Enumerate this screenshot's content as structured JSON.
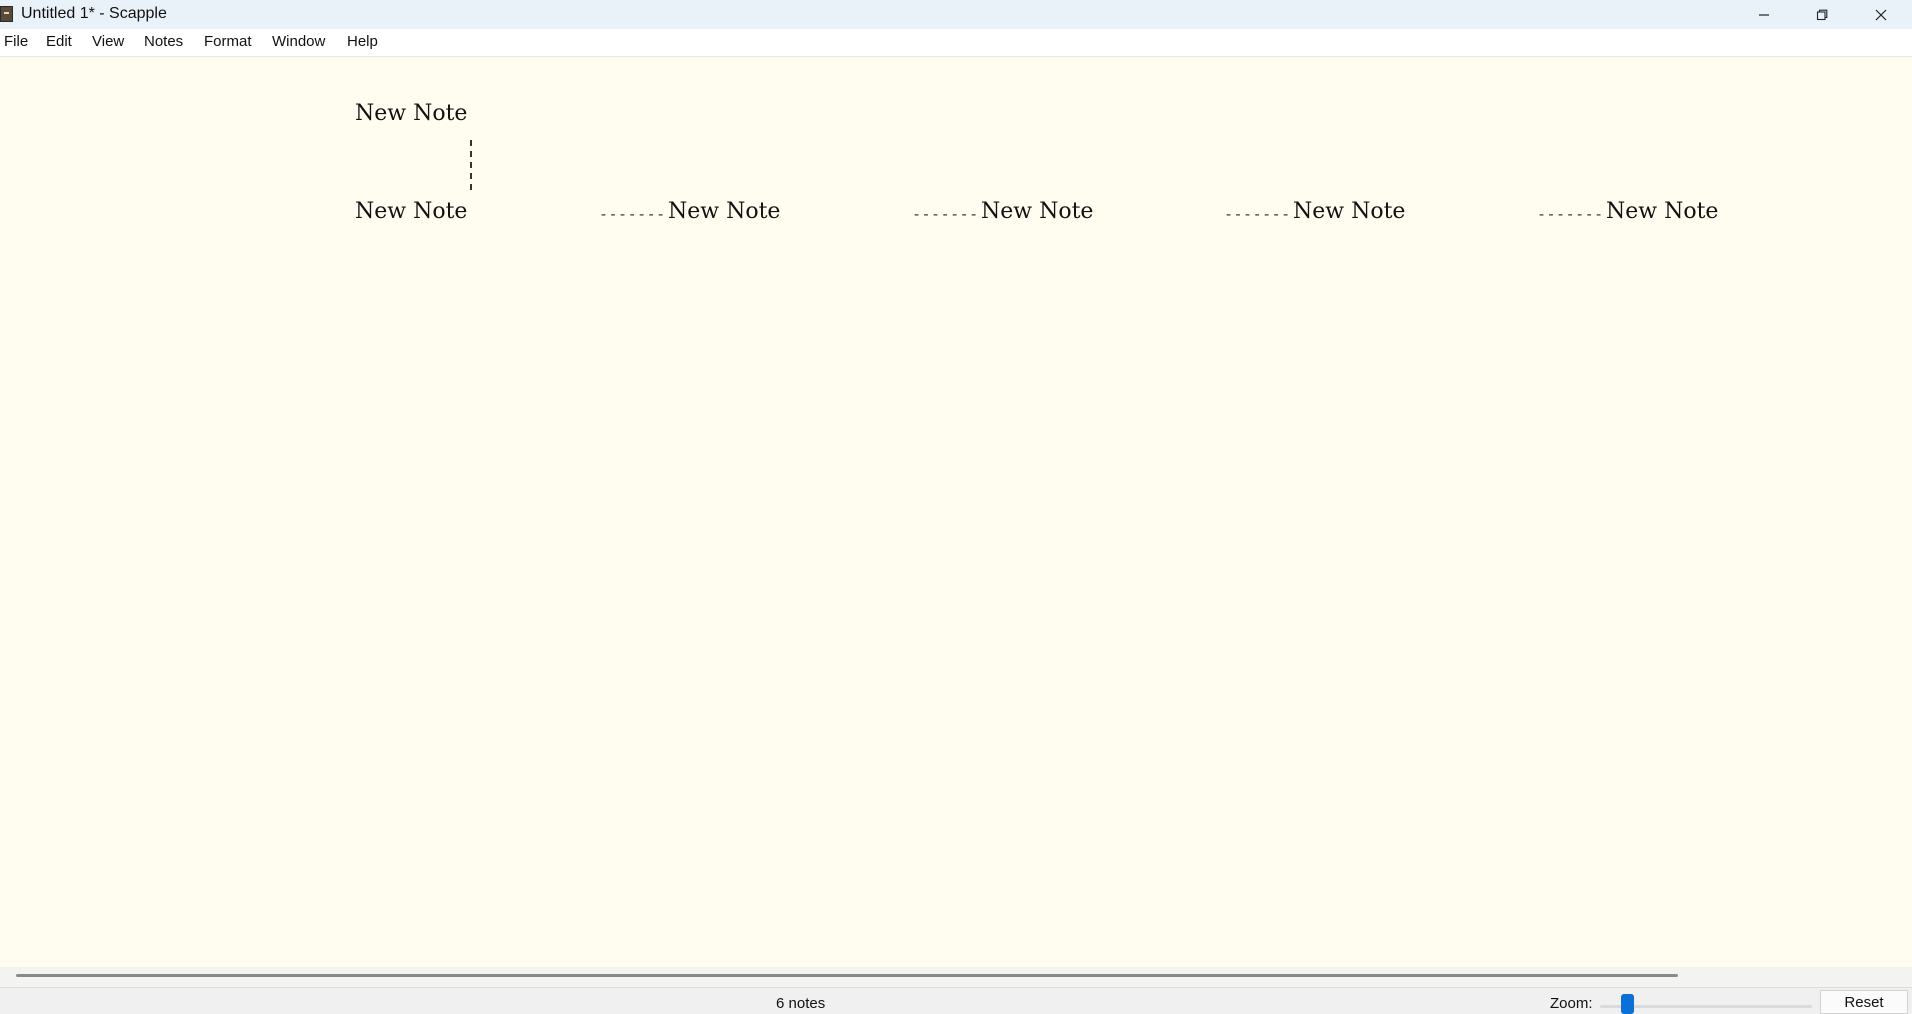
{
  "window": {
    "title": "Untitled 1* - Scapple",
    "app_icon": "scapple-app-icon",
    "controls": {
      "minimize_icon": "minimize-icon",
      "maximize_icon": "restore-icon",
      "close_icon": "close-icon"
    }
  },
  "menu": {
    "items": [
      {
        "label": "File"
      },
      {
        "label": "Edit"
      },
      {
        "label": "View"
      },
      {
        "label": "Notes"
      },
      {
        "label": "Format"
      },
      {
        "label": "Window"
      },
      {
        "label": "Help"
      }
    ]
  },
  "canvas": {
    "background": "#fffdf0",
    "notes": [
      {
        "text": "New Note"
      },
      {
        "text": "New Note"
      },
      {
        "text": "New Note"
      },
      {
        "text": "New Note"
      },
      {
        "text": "New Note"
      },
      {
        "text": "New Note"
      }
    ],
    "connectors": [
      {
        "text": "-------"
      },
      {
        "text": "-------"
      },
      {
        "text": "-------"
      },
      {
        "text": "-------"
      }
    ]
  },
  "status": {
    "note_count": "6 notes",
    "zoom_label": "Zoom:",
    "reset_label": "Reset",
    "accent": "#0a6fd6"
  }
}
